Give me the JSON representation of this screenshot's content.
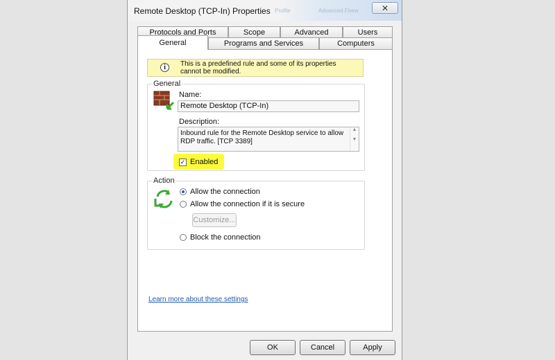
{
  "window": {
    "title": "Remote Desktop (TCP-In) Properties",
    "ghost_text_1": "Profile",
    "ghost_text_2": "Advanced Firew",
    "close_glyph": "✕"
  },
  "tabs_top": [
    {
      "label": "Protocols and Ports"
    },
    {
      "label": "Scope"
    },
    {
      "label": "Advanced"
    },
    {
      "label": "Users"
    }
  ],
  "tabs_bottom": [
    {
      "label": "General",
      "active": true
    },
    {
      "label": "Programs and Services"
    },
    {
      "label": "Computers"
    }
  ],
  "info": {
    "icon": "info-icon",
    "text": "This is a predefined rule and some of its properties cannot be modified."
  },
  "general": {
    "group_label": "General",
    "icon": "firewall-rule-icon",
    "name_label": "Name:",
    "name_value": "Remote Desktop (TCP-In)",
    "description_label": "Description:",
    "description_value": "Inbound rule for the Remote Desktop service to allow RDP traffic. [TCP 3389]",
    "enabled_label": "Enabled",
    "enabled": true,
    "highlight_color": "#fbfb3a"
  },
  "action": {
    "group_label": "Action",
    "icon": "action-arrows-icon",
    "options": [
      {
        "label": "Allow the connection",
        "selected": true
      },
      {
        "label": "Allow the connection if it is secure",
        "selected": false
      },
      {
        "label": "Block the connection",
        "selected": false
      }
    ],
    "customize_label": "Customize..."
  },
  "link_text": "Learn more about these settings",
  "buttons": {
    "ok": "OK",
    "cancel": "Cancel",
    "apply": "Apply"
  }
}
